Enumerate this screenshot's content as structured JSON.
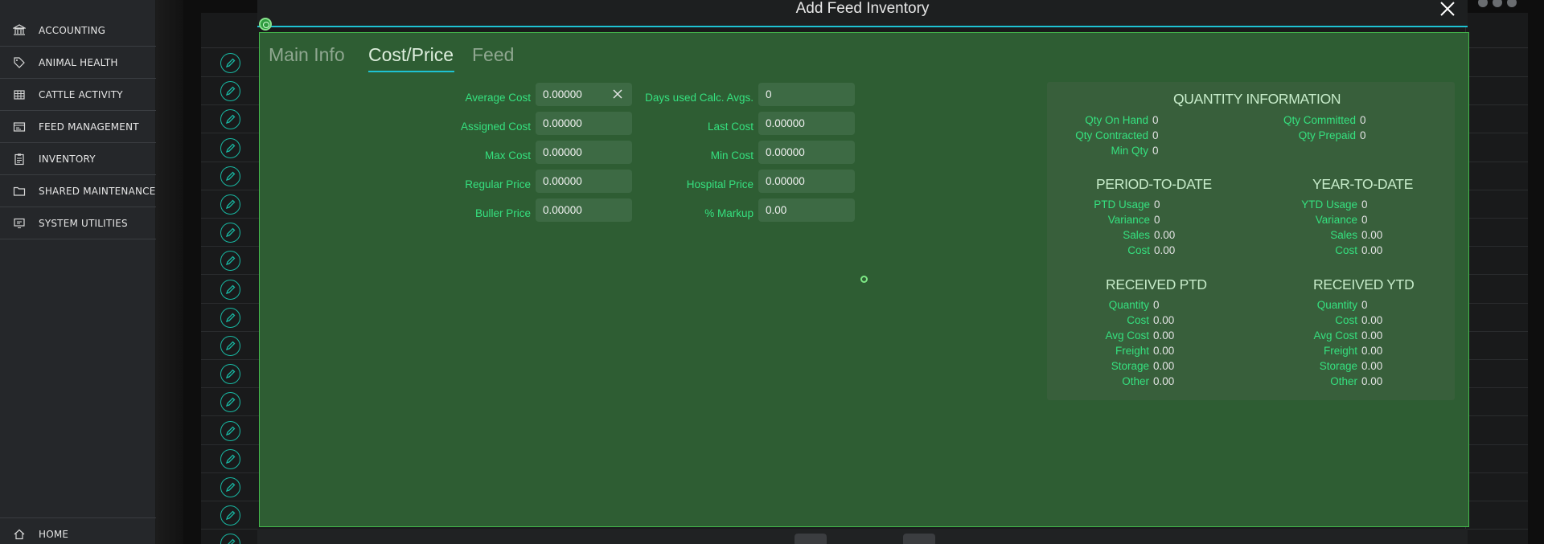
{
  "sidebar": {
    "items": [
      {
        "label": "ACCOUNTING",
        "icon": "bank-icon"
      },
      {
        "label": "ANIMAL HEALTH",
        "icon": "tag-icon"
      },
      {
        "label": "CATTLE ACTIVITY",
        "icon": "table-icon"
      },
      {
        "label": "FEED MANAGEMENT",
        "icon": "card-icon"
      },
      {
        "label": "INVENTORY",
        "icon": "clipboard-icon"
      },
      {
        "label": "SHARED MAINTENANCE",
        "icon": "folder-icon"
      },
      {
        "label": "SYSTEM UTILITIES",
        "icon": "monitor-icon"
      }
    ],
    "home": {
      "label": "HOME",
      "icon": "home-icon"
    }
  },
  "modal": {
    "title": "Add Feed Inventory",
    "tabs": [
      {
        "label": "Main Info",
        "active": false
      },
      {
        "label": "Cost/Price",
        "active": true
      },
      {
        "label": "Feed",
        "active": false
      }
    ],
    "cost": {
      "average_cost": {
        "label": "Average Cost",
        "value": "0.00000"
      },
      "assigned_cost": {
        "label": "Assigned Cost",
        "value": "0.00000"
      },
      "max_cost": {
        "label": "Max Cost",
        "value": "0.00000"
      },
      "regular_price": {
        "label": "Regular Price",
        "value": "0.00000"
      },
      "buller_price": {
        "label": "Buller Price",
        "value": "0.00000"
      },
      "days_used": {
        "label": "Days used Calc. Avgs.",
        "value": "0"
      },
      "last_cost": {
        "label": "Last Cost",
        "value": "0.00000"
      },
      "min_cost": {
        "label": "Min Cost",
        "value": "0.00000"
      },
      "hospital_price": {
        "label": "Hospital Price",
        "value": "0.00000"
      },
      "markup": {
        "label": "% Markup",
        "value": "0.00"
      }
    },
    "quantity": {
      "heading": "QUANTITY INFORMATION",
      "on_hand": {
        "label": "Qty On Hand",
        "value": "0"
      },
      "contracted": {
        "label": "Qty Contracted",
        "value": "0"
      },
      "min_qty": {
        "label": "Min Qty",
        "value": "0"
      },
      "committed": {
        "label": "Qty Committed",
        "value": "0"
      },
      "prepaid": {
        "label": "Qty Prepaid",
        "value": "0"
      }
    },
    "ptd": {
      "heading": "PERIOD-TO-DATE",
      "usage": {
        "label": "PTD Usage",
        "value": "0"
      },
      "variance": {
        "label": "Variance",
        "value": "0"
      },
      "sales": {
        "label": "Sales",
        "value": "0.00"
      },
      "cost": {
        "label": "Cost",
        "value": "0.00"
      }
    },
    "ytd": {
      "heading": "YEAR-TO-DATE",
      "usage": {
        "label": "YTD Usage",
        "value": "0"
      },
      "variance": {
        "label": "Variance",
        "value": "0"
      },
      "sales": {
        "label": "Sales",
        "value": "0.00"
      },
      "cost": {
        "label": "Cost",
        "value": "0.00"
      }
    },
    "received_ptd": {
      "heading": "RECEIVED PTD",
      "quantity": {
        "label": "Quantity",
        "value": "0"
      },
      "cost": {
        "label": "Cost",
        "value": "0.00"
      },
      "avg_cost": {
        "label": "Avg Cost",
        "value": "0.00"
      },
      "freight": {
        "label": "Freight",
        "value": "0.00"
      },
      "storage": {
        "label": "Storage",
        "value": "0.00"
      },
      "other": {
        "label": "Other",
        "value": "0.00"
      }
    },
    "received_ytd": {
      "heading": "RECEIVED YTD",
      "quantity": {
        "label": "Quantity",
        "value": "0"
      },
      "cost": {
        "label": "Cost",
        "value": "0.00"
      },
      "avg_cost": {
        "label": "Avg Cost",
        "value": "0.00"
      },
      "freight": {
        "label": "Freight",
        "value": "0.00"
      },
      "storage": {
        "label": "Storage",
        "value": "0.00"
      },
      "other": {
        "label": "Other",
        "value": "0.00"
      }
    }
  },
  "colors": {
    "accent": "#1ec2d2",
    "label_green": "#35e07f",
    "modal_bg": "#2e5d33",
    "sidebar_bg": "#25272a"
  }
}
